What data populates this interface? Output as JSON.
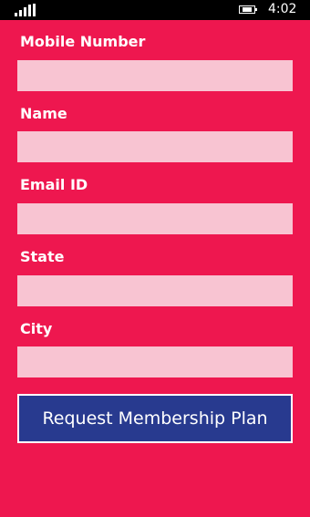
{
  "status_bar": {
    "time": "4:02",
    "signal_icon": "signal-strength-icon",
    "battery_icon": "battery-charging-icon"
  },
  "form": {
    "mobile_label": "Mobile Number",
    "mobile_value": "",
    "name_label": "Name",
    "name_value": "",
    "email_label": "Email ID",
    "email_value": "",
    "state_label": "State",
    "state_value": "",
    "city_label": "City",
    "city_value": "",
    "submit_label": "Request Membership Plan"
  },
  "colors": {
    "background": "#ee174f",
    "input_fill": "#f8c4d2",
    "button_fill": "#283a8f",
    "status_bar": "#000000"
  }
}
